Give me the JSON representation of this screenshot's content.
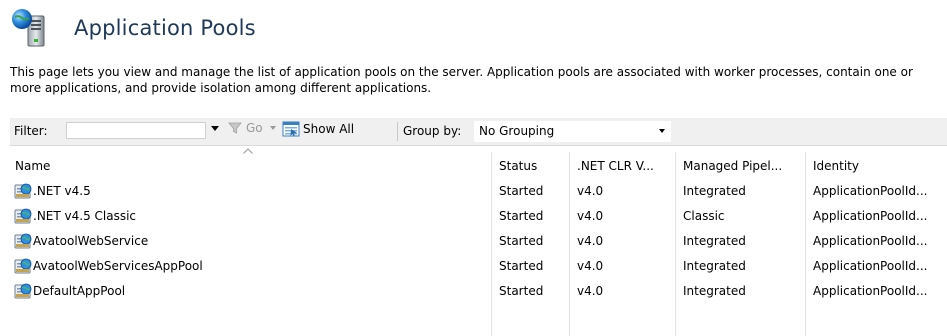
{
  "page": {
    "title": "Application Pools",
    "description": "This page lets you view and manage the list of application pools on the server. Application pools are associated with worker processes, contain one or more applications, and provide isolation among different applications."
  },
  "toolbar": {
    "filter_label": "Filter:",
    "filter_value": "",
    "go_label": "Go",
    "show_all_label": "Show All",
    "group_by_label": "Group by:",
    "group_by_value": "No Grouping"
  },
  "grid": {
    "columns": [
      "Name",
      "Status",
      ".NET CLR V...",
      "Managed Pipel...",
      "Identity"
    ],
    "rows": [
      {
        "name": ".NET v4.5",
        "status": "Started",
        "clr": "v4.0",
        "pipeline": "Integrated",
        "identity": "ApplicationPoolId..."
      },
      {
        "name": ".NET v4.5 Classic",
        "status": "Started",
        "clr": "v4.0",
        "pipeline": "Classic",
        "identity": "ApplicationPoolId..."
      },
      {
        "name": "AvatoolWebService",
        "status": "Started",
        "clr": "v4.0",
        "pipeline": "Integrated",
        "identity": "ApplicationPoolId..."
      },
      {
        "name": "AvatoolWebServicesAppPool",
        "status": "Started",
        "clr": "v4.0",
        "pipeline": "Integrated",
        "identity": "ApplicationPoolId..."
      },
      {
        "name": "DefaultAppPool",
        "status": "Started",
        "clr": "v4.0",
        "pipeline": "Integrated",
        "identity": "ApplicationPoolId..."
      }
    ]
  },
  "icons": {
    "header": "app-pools-server-icon",
    "go": "funnel-icon",
    "show_all": "show-all-icon",
    "row": "application-pool-icon"
  },
  "colors": {
    "title": "#1e395b",
    "toolbar_bg": "#f0f0f0",
    "disabled_text": "#9a9a9a"
  }
}
